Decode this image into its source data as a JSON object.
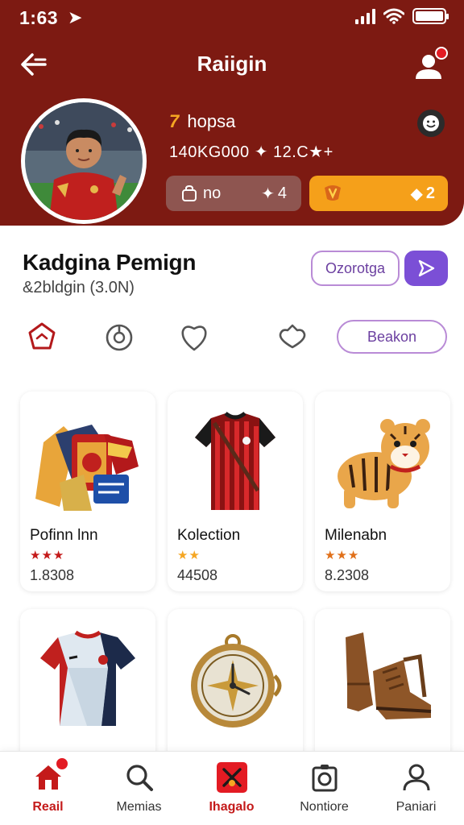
{
  "status_bar": {
    "time": "1:63",
    "nav_arrow": "➤"
  },
  "header": {
    "title": "Raiigin",
    "rank_number": "7",
    "rank_label": "hopsa",
    "stats": "140KG000 ✦ 12.C★+",
    "grey_pill_label": "no",
    "grey_pill_value": "4",
    "orange_pill_value": "2"
  },
  "section": {
    "title": "Kadgina Pemign",
    "subtitle": "&2bldgin (3.0N)",
    "outline_button": "Ozorotga",
    "filter_pill": "Beakon"
  },
  "products": [
    {
      "title": "Pofinn lnn",
      "stars": "★★★",
      "price": "1.8308",
      "star_color": "#c41a1a"
    },
    {
      "title": "Kolection",
      "stars": "★★",
      "price": "44508",
      "star_color": "#f5a623"
    },
    {
      "title": "Milenabn",
      "stars": "★★★",
      "price": "8.2308",
      "star_color": "#e0701a"
    },
    {
      "title": "",
      "stars": "",
      "price": "",
      "star_color": "#c41a1a"
    },
    {
      "title": "",
      "stars": "",
      "price": "",
      "star_color": "#c41a1a"
    },
    {
      "title": "",
      "stars": "",
      "price": "",
      "star_color": "#c41a1a"
    }
  ],
  "bottom_nav": [
    {
      "label": "Reail",
      "icon": "home-icon",
      "active": true
    },
    {
      "label": "Memias",
      "icon": "search-icon",
      "active": false
    },
    {
      "label": "Ihagalo",
      "icon": "sports-icon",
      "active": true
    },
    {
      "label": "Nontiore",
      "icon": "camera-icon",
      "active": false
    },
    {
      "label": "Paniari",
      "icon": "user-icon",
      "active": false
    }
  ],
  "colors": {
    "header_bg": "#7d1a12",
    "accent_orange": "#f5a01a",
    "accent_purple": "#7b4fd6",
    "nav_active": "#c41a1a"
  }
}
